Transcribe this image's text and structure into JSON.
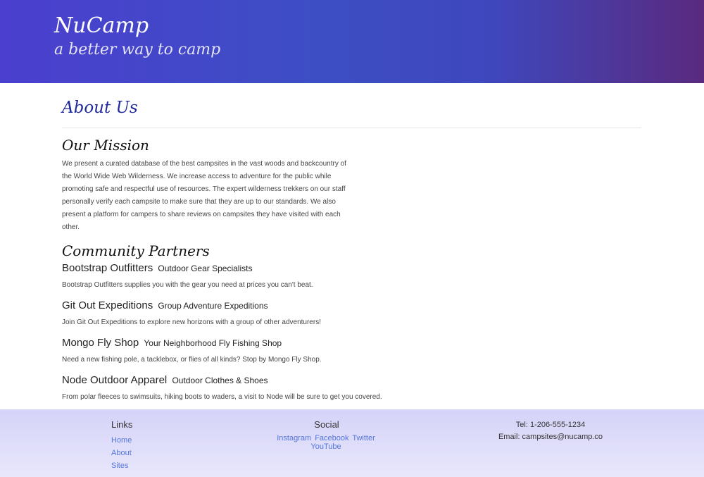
{
  "header": {
    "brand": "NuCamp",
    "tagline": "a better way to camp"
  },
  "page": {
    "title": "About Us"
  },
  "mission": {
    "heading": "Our Mission",
    "text": "We present a curated database of the best campsites in the vast woods and backcountry of the World Wide Web Wilderness. We increase access to adventure for the public while promoting safe and respectful use of resources. The expert wilderness trekkers on our staff personally verify each campsite to make sure that they are up to our standards. We also present a platform for campers to share reviews on campsites they have visited with each other."
  },
  "partners": {
    "heading": "Community Partners",
    "items": [
      {
        "name": "Bootstrap Outfitters",
        "subtitle": "Outdoor Gear Specialists",
        "description": "Bootstrap Outfitters supplies you with the gear you need at prices you can't beat."
      },
      {
        "name": "Git Out Expeditions",
        "subtitle": "Group Adventure Expeditions",
        "description": "Join Git Out Expeditions to explore new horizons with a group of other adventurers!"
      },
      {
        "name": "Mongo Fly Shop",
        "subtitle": "Your Neighborhood Fly Fishing Shop",
        "description": "Need a new fishing pole, a tacklebox, or flies of all kinds? Stop by Mongo Fly Shop."
      },
      {
        "name": "Node Outdoor Apparel",
        "subtitle": "Outdoor Clothes & Shoes",
        "description": "From polar fleeces to swimsuits, hiking boots to waders, a visit to Node will be sure to get you covered."
      }
    ]
  },
  "footer": {
    "links": {
      "heading": "Links",
      "items": [
        "Home",
        "About",
        "Sites"
      ]
    },
    "social": {
      "heading": "Social",
      "items": [
        "Instagram",
        "Facebook",
        "Twitter",
        "YouTube"
      ]
    },
    "contact": {
      "tel": "Tel: 1-206-555-1234",
      "email": "Email: campsites@nucamp.co"
    }
  }
}
